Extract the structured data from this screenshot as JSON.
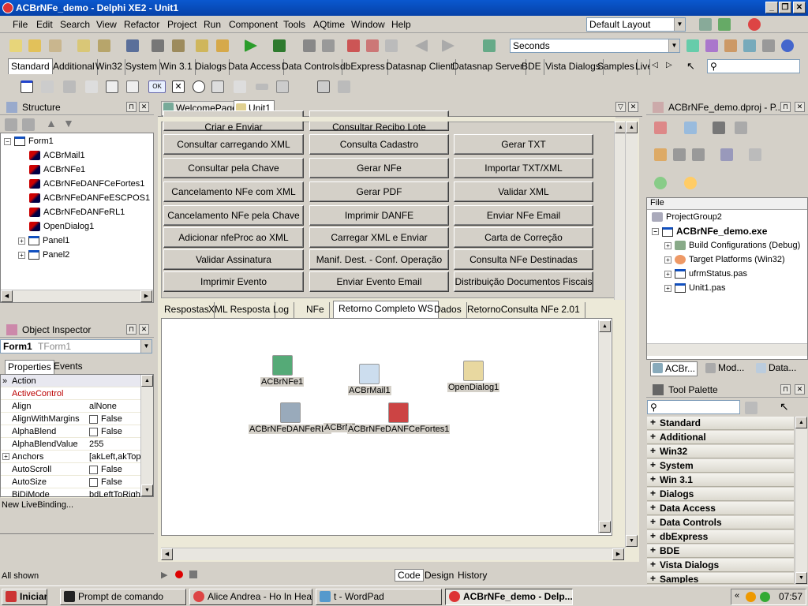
{
  "window": {
    "title": "ACBrNFe_demo - Delphi XE2 - Unit1"
  },
  "menu": [
    "File",
    "Edit",
    "Search",
    "View",
    "Refactor",
    "Project",
    "Run",
    "Component",
    "Tools",
    "AQtime",
    "Window",
    "Help"
  ],
  "toolbar": {
    "layout": "Default Layout",
    "units": "Seconds",
    "search_placeholder": ""
  },
  "palette_tabs": [
    "Standard",
    "Additional",
    "Win32",
    "System",
    "Win 3.1",
    "Dialogs",
    "Data Access",
    "Data Controls",
    "dbExpress",
    "Datasnap Client",
    "Datasnap Server",
    "BDE",
    "Vista Dialogs",
    "Samples",
    "Live"
  ],
  "structure": {
    "title": "Structure",
    "root": "Form1",
    "items": [
      "ACBrMail1",
      "ACBrNFe1",
      "ACBrNFeDANFCeFortes1",
      "ACBrNFeDANFeESCPOS1",
      "ACBrNFeDANFeRL1",
      "OpenDialog1",
      "Panel1",
      "Panel2"
    ]
  },
  "object_inspector": {
    "title": "Object Inspector",
    "object": "Form1",
    "type": "TForm1",
    "tab_properties": "Properties",
    "tab_events": "Events",
    "rows": [
      {
        "name": "Action",
        "value": ""
      },
      {
        "name": "ActiveControl",
        "value": ""
      },
      {
        "name": "Align",
        "value": "alNone"
      },
      {
        "name": "AlignWithMargins",
        "value": "False"
      },
      {
        "name": "AlphaBlend",
        "value": "False"
      },
      {
        "name": "AlphaBlendValue",
        "value": "255"
      },
      {
        "name": "Anchors",
        "value": "[akLeft,akTop"
      },
      {
        "name": "AutoScroll",
        "value": "False"
      },
      {
        "name": "AutoSize",
        "value": "False"
      },
      {
        "name": "BiDiMode",
        "value": "bdLeftToRigh"
      }
    ],
    "livebinding": "New LiveBinding...",
    "status": "All shown"
  },
  "editor_tabs": [
    "WelcomePage",
    "Unit1"
  ],
  "top_cut_buttons": [
    "Criar e Enviar",
    "Consultar Recibo Lote"
  ],
  "buttons": [
    [
      "Consultar carregando XML",
      "Consulta Cadastro",
      "Gerar TXT"
    ],
    [
      "Consultar pela Chave",
      "Gerar NFe",
      "Importar TXT/XML"
    ],
    [
      "Cancelamento NFe com XML",
      "Gerar PDF",
      "Validar XML"
    ],
    [
      "Cancelamento NFe pela Chave",
      "Imprimir DANFE",
      "Enviar NFe Email"
    ],
    [
      "Adicionar nfeProc ao XML",
      "Carregar XML e Enviar",
      "Carta de Correção"
    ],
    [
      "Validar Assinatura",
      "Manif. Dest. - Conf. Operação",
      "Consulta NFe Destinadas"
    ],
    [
      "Imprimir Evento",
      "Enviar Evento Email",
      "Distribuição Documentos Fiscais"
    ]
  ],
  "designer_tabs": [
    "Respostas",
    "XML Resposta",
    "Log",
    "NFe",
    "Retorno Completo WS",
    "Dados",
    "RetornoConsulta NFe 2.01"
  ],
  "nonvisual": {
    "c1": "ACBrNFe1",
    "c2": "ACBrMail1",
    "c3": "OpenDialog1",
    "c4": "ACBrNFeDANFeRL1",
    "c5": "ACBrNF",
    "c6": "ACBrNFeDANFCeFortes1"
  },
  "bottom_tabs": [
    "Code",
    "Design",
    "History"
  ],
  "project": {
    "title": "ACBrNFe_demo.dproj - P...",
    "col": "File",
    "group": "ProjectGroup2",
    "exe": "ACBrNFe_demo.exe",
    "items": [
      "Build Configurations (Debug)",
      "Target Platforms (Win32)",
      "ufrmStatus.pas",
      "Unit1.pas"
    ],
    "tabs": [
      "ACBr...",
      "Mod...",
      "Data..."
    ]
  },
  "tool_palette": {
    "title": "Tool Palette",
    "cats": [
      "Standard",
      "Additional",
      "Win32",
      "System",
      "Win 3.1",
      "Dialogs",
      "Data Access",
      "Data Controls",
      "dbExpress",
      "BDE",
      "Vista Dialogs",
      "Samples"
    ]
  },
  "taskbar": {
    "start": "Iniciar",
    "tasks": [
      "Prompt de comando",
      "Alice Andrea - Ho In Hea...",
      "t - WordPad",
      "ACBrNFe_demo - Delp..."
    ],
    "clock": "07:57"
  }
}
